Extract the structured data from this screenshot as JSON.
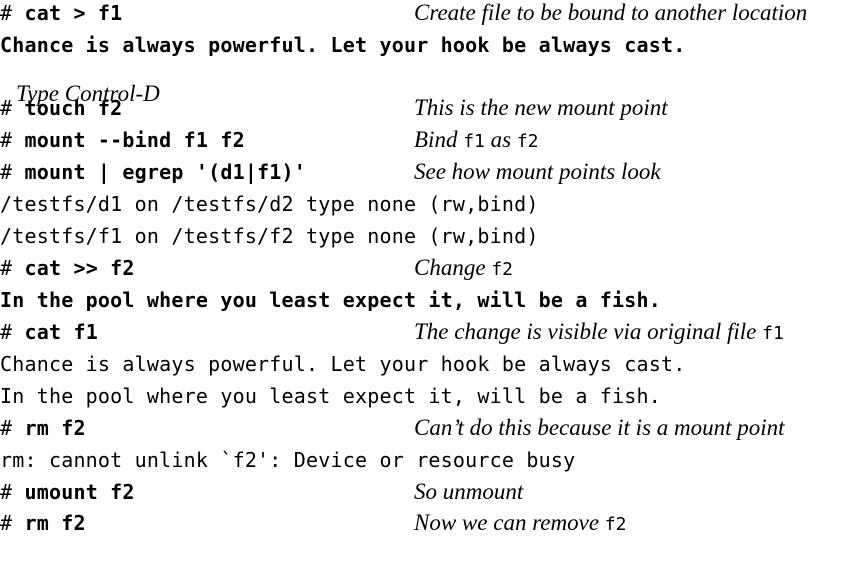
{
  "lines": [
    {
      "prompt": "# ",
      "command": "cat > f1",
      "comment": "Create file to be bound to another location"
    },
    {
      "output_bold": "Chance is always powerful. Let your hook be always cast."
    },
    {
      "italic_note": "Type Control-D"
    },
    {
      "prompt": "# ",
      "command": "touch f2",
      "comment": "This is the new mount point"
    },
    {
      "prompt": "# ",
      "command": "mount --bind f1 f2",
      "comment_prefix": "Bind ",
      "comment_code1": "f1",
      "comment_mid": " as ",
      "comment_code2": "f2"
    },
    {
      "prompt": "# ",
      "command": "mount | egrep '(d1|f1)'",
      "comment": "See how mount points look"
    },
    {
      "output": "/testfs/d1 on /testfs/d2 type none (rw,bind)"
    },
    {
      "output": "/testfs/f1 on /testfs/f2 type none (rw,bind)"
    },
    {
      "prompt": "# ",
      "command": "cat >> f2",
      "comment_prefix": "Change ",
      "comment_code1": "f2"
    },
    {
      "output_bold": "In the pool where you least expect it, will be a fish."
    },
    {
      "prompt": "# ",
      "command": "cat f1",
      "comment_prefix": "The change is visible via original file ",
      "comment_code1": "f1"
    },
    {
      "output": "Chance is always powerful. Let your hook be always cast."
    },
    {
      "output": "In the pool where you least expect it, will be a fish."
    },
    {
      "prompt": "# ",
      "command": "rm f2",
      "comment": "Can’t do this because it is a mount point"
    },
    {
      "output": "rm: cannot unlink `f2': Device or resource busy"
    },
    {
      "prompt": "# ",
      "command": "umount f2",
      "comment": "So unmount"
    },
    {
      "prompt": "# ",
      "command": "rm f2",
      "comment_prefix": "Now we can remove ",
      "comment_code1": "f2"
    }
  ]
}
